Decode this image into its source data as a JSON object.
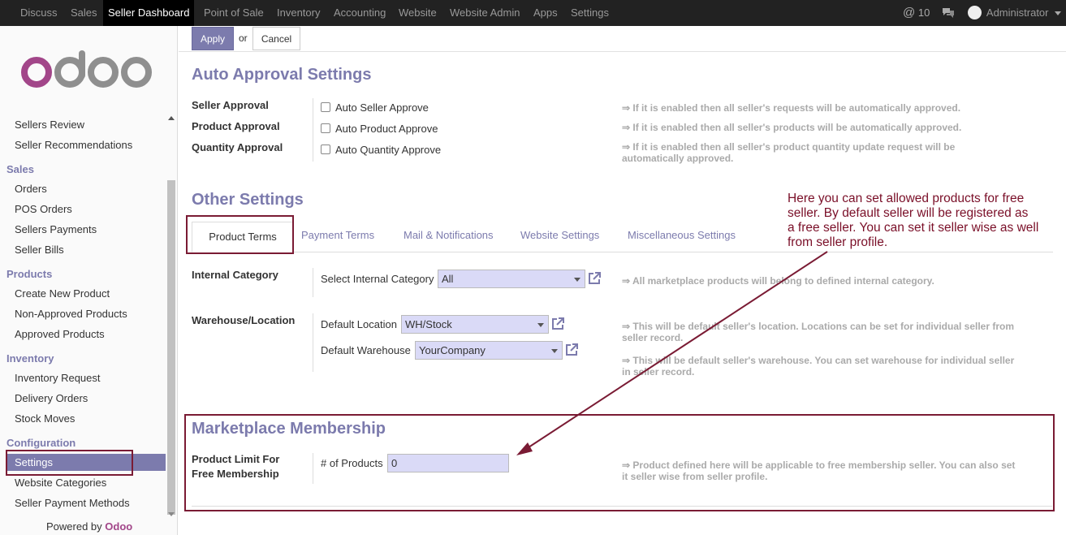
{
  "topnav": {
    "items": [
      "Discuss",
      "Sales",
      "Seller Dashboard",
      "Point of Sale",
      "Inventory",
      "Accounting",
      "Website",
      "Website Admin",
      "Apps",
      "Settings"
    ],
    "active": "Seller Dashboard",
    "mentions_count": "10",
    "user": "Administrator"
  },
  "sidebar": {
    "logo": "odoo",
    "items_top": [
      "Sellers Review",
      "Seller Recommendations"
    ],
    "sales": {
      "heading": "Sales",
      "items": [
        "Orders",
        "POS Orders",
        "Sellers Payments",
        "Seller Bills"
      ]
    },
    "products": {
      "heading": "Products",
      "items": [
        "Create New Product",
        "Non-Approved Products",
        "Approved Products"
      ]
    },
    "inventory": {
      "heading": "Inventory",
      "items": [
        "Inventory Request",
        "Delivery Orders",
        "Stock Moves"
      ]
    },
    "configuration": {
      "heading": "Configuration",
      "items": [
        "Settings",
        "Website Categories",
        "Seller Payment Methods"
      ]
    },
    "powered_by": "Powered by",
    "powered_brand": "Odoo"
  },
  "actions": {
    "apply": "Apply",
    "or": "or",
    "cancel": "Cancel"
  },
  "auto_approval": {
    "title": "Auto Approval Settings",
    "rows": [
      {
        "label": "Seller Approval",
        "checkbox": "Auto Seller Approve",
        "help": "⇒ If it is enabled then all seller's requests will be automatically approved."
      },
      {
        "label": "Product Approval",
        "checkbox": "Auto Product Approve",
        "help": "⇒ If it is enabled then all seller's products will be automatically approved."
      },
      {
        "label": "Quantity Approval",
        "checkbox": "Auto Quantity Approve",
        "help_line1": "⇒ If it is enabled then all seller's product quantity update request will be",
        "help_line2": "automatically approved."
      }
    ]
  },
  "other_settings": {
    "title": "Other Settings",
    "tabs": [
      "Product Terms",
      "Payment Terms",
      "Mail & Notifications",
      "Website Settings",
      "Miscellaneous Settings"
    ],
    "internal_category": {
      "label": "Internal Category",
      "field_label": "Select Internal Category",
      "value": "All",
      "help": "⇒ All marketplace products will belong to defined internal category."
    },
    "warehouse": {
      "label": "Warehouse/Location",
      "location_label": "Default Location",
      "location_value": "WH/Stock",
      "warehouse_label": "Default Warehouse",
      "warehouse_value": "YourCompany",
      "help_location_1": "⇒ This will be default seller's location. Locations can be set for individual seller from",
      "help_location_2": "seller record.",
      "help_warehouse_1": "⇒ This will be default seller's warehouse. You can set warehouse for individual seller",
      "help_warehouse_2": "in seller record."
    }
  },
  "membership": {
    "title": "Marketplace Membership",
    "label_1": "Product Limit For",
    "label_2": "Free Membership",
    "field_label": "# of Products",
    "value": "0",
    "help_1": "⇒ Product defined here will be applicable to free membership seller. You can also set",
    "help_2": "it seller wise from seller profile."
  },
  "annotation": {
    "line1": "Here you can set allowed products for free",
    "line2": "seller. By default seller will be registered as",
    "line3": "a free seller. You can set it seller wise as well",
    "line4": "from seller profile."
  },
  "colors": {
    "accent": "#7c7bad",
    "annotation": "#7a0f28",
    "topbar": "#222222"
  }
}
